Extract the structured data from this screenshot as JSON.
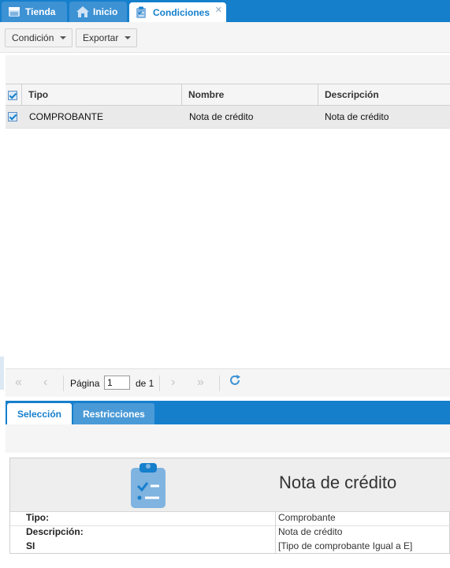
{
  "tabs": [
    {
      "label": "Tienda",
      "icon": "store-icon"
    },
    {
      "label": "Inicio",
      "icon": "home-icon"
    },
    {
      "label": "Condiciones",
      "icon": "clipboard-icon",
      "close": "✕"
    }
  ],
  "toolbar": {
    "condicion_label": "Condición",
    "exportar_label": "Exportar"
  },
  "grid": {
    "columns": [
      "Tipo",
      "Nombre",
      "Descripción"
    ],
    "rows": [
      {
        "tipo": "COMPROBANTE",
        "nombre": "Nota de crédito",
        "descripcion": "Nota de crédito"
      }
    ]
  },
  "pager": {
    "page_label": "Página",
    "page_value": "1",
    "of_label": "de 1"
  },
  "subtabs": [
    "Selección",
    "Restricciones"
  ],
  "detail": {
    "title": "Nota de crédito",
    "fields": [
      {
        "key": "Tipo:",
        "value": "Comprobante"
      },
      {
        "key": "Descripción:",
        "value": "Nota de crédito"
      },
      {
        "key": "SI",
        "value": "[Tipo de comprobante Igual a E]"
      }
    ]
  },
  "colors": {
    "accent": "#157fcc",
    "tab_inactive": "#3d92d4",
    "icon_light": "#7fb3e0"
  }
}
